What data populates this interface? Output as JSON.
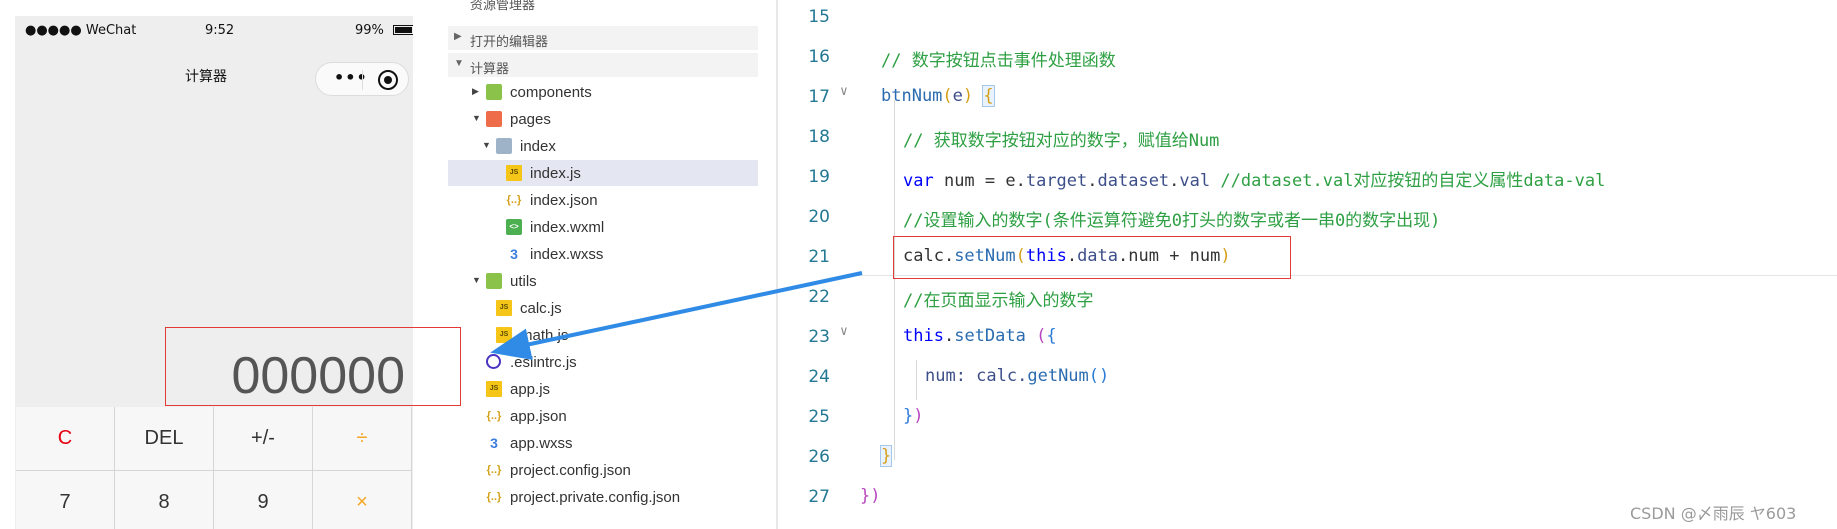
{
  "phone": {
    "status": {
      "carrier": "●●●●● WeChat",
      "time": "9:52",
      "battery": "99%"
    },
    "nav_title": "计算器",
    "display_value": "000000",
    "keys_row1": [
      "C",
      "DEL",
      "+/-",
      "÷"
    ],
    "keys_row2": [
      "7",
      "8",
      "9",
      "×"
    ]
  },
  "explorer": {
    "header": "资源管理器",
    "more": "···",
    "section_open_editors": "打开的编辑器",
    "section_project": "计算器",
    "items": [
      {
        "name": "components",
        "icon": "folder-icon"
      },
      {
        "name": "pages",
        "icon": "folder-icon"
      },
      {
        "name": "index",
        "icon": "folder-open-icon"
      },
      {
        "name": "index.js",
        "icon": "js-file-icon"
      },
      {
        "name": "index.json",
        "icon": "json-file-icon"
      },
      {
        "name": "index.wxml",
        "icon": "wxml-file-icon"
      },
      {
        "name": "index.wxss",
        "icon": "wxss-file-icon"
      },
      {
        "name": "utils",
        "icon": "folder-icon"
      },
      {
        "name": "calc.js",
        "icon": "js-file-icon"
      },
      {
        "name": "math.js",
        "icon": "js-file-icon"
      },
      {
        "name": ".eslintrc.js",
        "icon": "eslint-icon"
      },
      {
        "name": "app.js",
        "icon": "js-file-icon"
      },
      {
        "name": "app.json",
        "icon": "json-file-icon"
      },
      {
        "name": "app.wxss",
        "icon": "wxss-file-icon"
      },
      {
        "name": "project.config.json",
        "icon": "json-file-icon"
      },
      {
        "name": "project.private.config.json",
        "icon": "json-file-icon"
      }
    ],
    "icon_labels": {
      "js": "JS",
      "json": "{..}",
      "wxml": "<>",
      "wxss": "3"
    }
  },
  "editor": {
    "line_numbers": [
      "15",
      "16",
      "17",
      "18",
      "19",
      "20",
      "21",
      "22",
      "23",
      "24",
      "25",
      "26",
      "27"
    ],
    "l16": "// 数字按钮点击事件处理函数",
    "l17_fn": "btnNum",
    "l17_open": "(",
    "l17_param": "e",
    "l17_close": ")",
    "l17_brace": "{",
    "l18": "// 获取数字按钮对应的数字，赋值给Num",
    "l19_kw": "var",
    "l19_a": " num = e.",
    "l19_b": "target",
    "l19_c": ".",
    "l19_d": "dataset",
    "l19_e": ".",
    "l19_f": "val",
    "l19_cmt": " //dataset.val对应按钮的自定义属性data-val",
    "l20": "//设置输入的数字(条件运算符避免0打头的数字或者一串0的数字出现)",
    "l21_a": "calc.",
    "l21_fn": "setNum",
    "l21_open": "(",
    "l21_this": "this",
    "l21_b": ".",
    "l21_data": "data",
    "l21_c": ".num + num",
    "l21_close": ")",
    "l22": "//在页面显示输入的数字",
    "l23_this": "this",
    "l23_dot": ".",
    "l23_fn": "setData",
    "l23_space": " ",
    "l23_open": "(",
    "l23_brace": "{",
    "l24_a": "num: calc.",
    "l24_fn": "getNum",
    "l24_parens": "()",
    "l25_a": "}",
    "l25_b": ")",
    "l26": "}",
    "l27": "})",
    "watermark": "CSDN @〆雨辰    ヤ603"
  }
}
